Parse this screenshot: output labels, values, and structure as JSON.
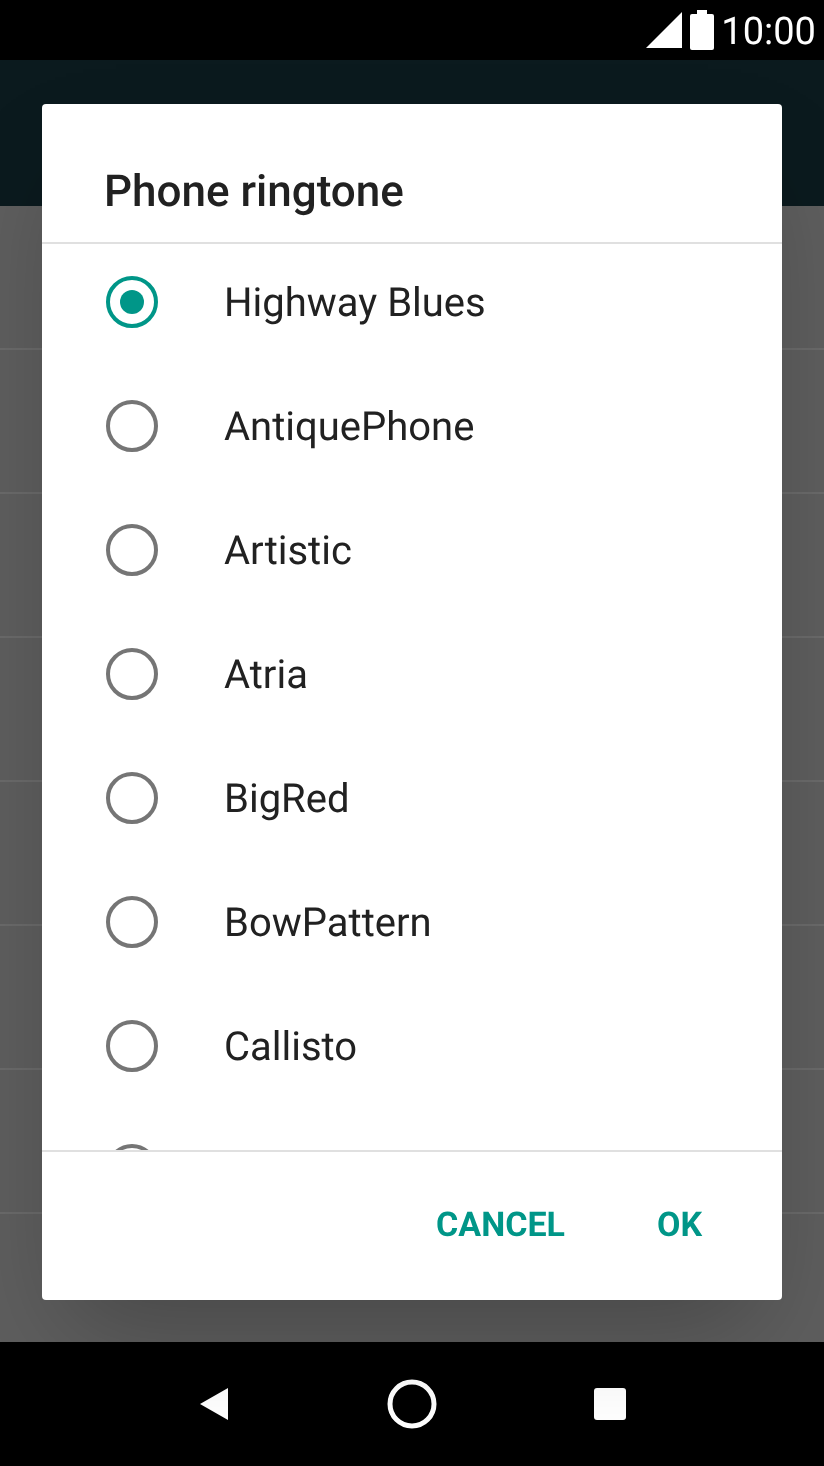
{
  "status_bar": {
    "time": "10:00"
  },
  "dialog": {
    "title": "Phone ringtone",
    "options": [
      {
        "label": "Highway Blues",
        "selected": true
      },
      {
        "label": "AntiquePhone",
        "selected": false
      },
      {
        "label": "Artistic",
        "selected": false
      },
      {
        "label": "Atria",
        "selected": false
      },
      {
        "label": "BigRed",
        "selected": false
      },
      {
        "label": "BowPattern",
        "selected": false
      },
      {
        "label": "Callisto",
        "selected": false
      }
    ],
    "partial_option": {
      "selected": false
    },
    "buttons": [
      "CANCEL",
      "OK"
    ]
  }
}
